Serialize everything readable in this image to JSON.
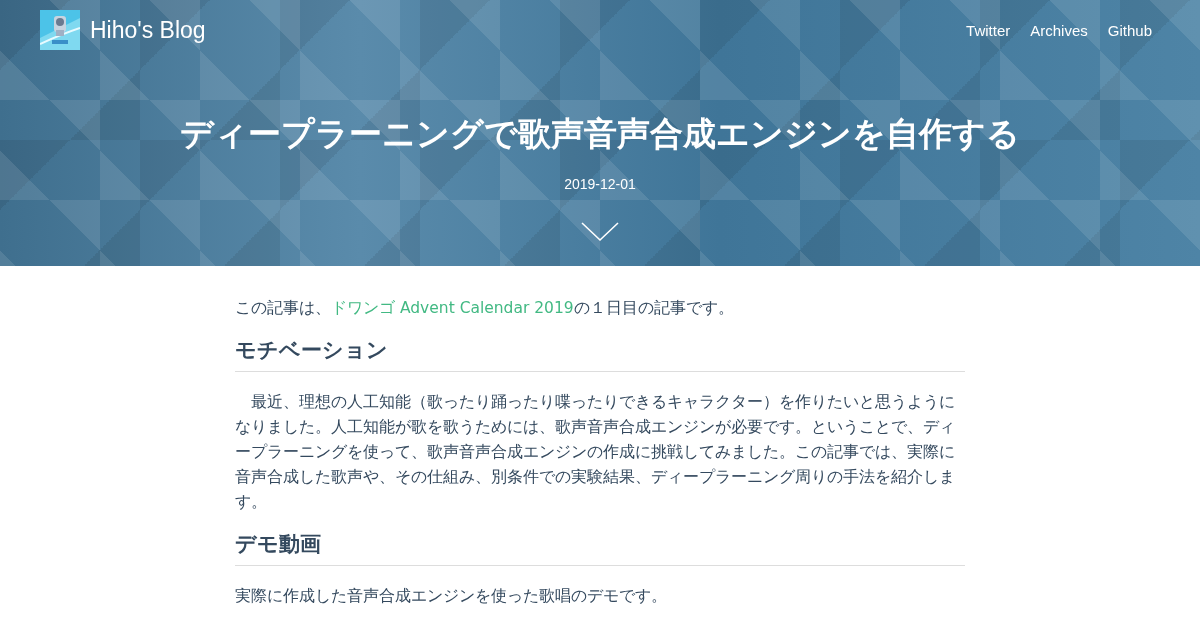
{
  "header": {
    "blog_title": "Hiho's Blog",
    "nav": [
      {
        "label": "Twitter"
      },
      {
        "label": "Archives"
      },
      {
        "label": "Github"
      }
    ],
    "post_title": "ディープラーニングで歌声音声合成エンジンを自作する",
    "date": "2019-12-01"
  },
  "article": [
    {
      "kind": "paragraph",
      "parts": [
        {
          "text": "この記事は、"
        },
        {
          "text": "ドワンゴ Advent Calendar 2019",
          "link": true
        },
        {
          "text": "の１日目の記事です。"
        }
      ]
    },
    {
      "kind": "heading",
      "text": "モチベーション"
    },
    {
      "kind": "paragraph",
      "parts": [
        {
          "text": "　最近、理想の人工知能（歌ったり踊ったり喋ったりできるキャラクター）を作りたいと思うようになりました。人工知能が歌を歌うためには、歌声音声合成エンジンが必要です。ということで、ディープラーニングを使って、歌声音声合成エンジンの作成に挑戦してみました。この記事では、実際に音声合成した歌声や、その仕組み、別条件での実験結果、ディープラーニング周りの手法を紹介します。"
        }
      ]
    },
    {
      "kind": "heading",
      "text": "デモ動画"
    },
    {
      "kind": "paragraph",
      "parts": [
        {
          "text": "実際に作成した音声合成エンジンを使った歌唱のデモです。"
        }
      ]
    }
  ]
}
